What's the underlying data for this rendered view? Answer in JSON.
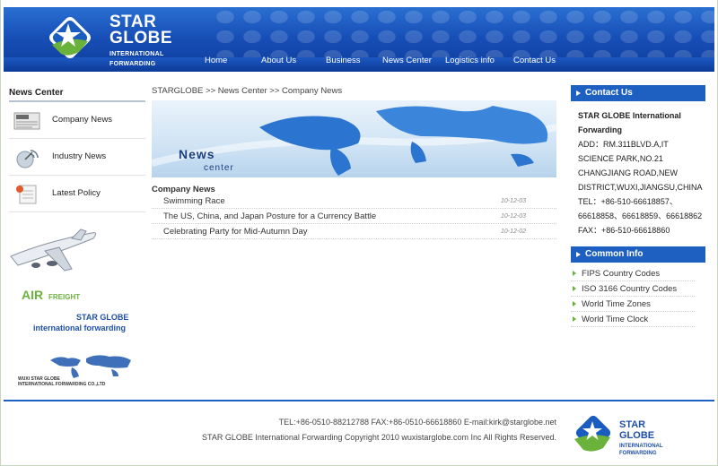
{
  "brand": {
    "line1": "STAR",
    "line2": "GLOBE",
    "line3": "INTERNATIONAL",
    "line4": "FORWARDING",
    "blue": "#1e5fc2",
    "green": "#6bb23c"
  },
  "nav": [
    "Home",
    "About Us",
    "Business",
    "News Center",
    "Logistics info",
    "Contact Us"
  ],
  "sidebar": {
    "title": "News Center",
    "items": [
      {
        "label": "Company News",
        "icon": "newspaper-icon"
      },
      {
        "label": "Industry News",
        "icon": "satellite-icon"
      },
      {
        "label": "Latest Policy",
        "icon": "document-icon"
      }
    ],
    "promo": {
      "air": "AIR",
      "freight": "FREIGHT",
      "brand1": "STAR GLOBE",
      "brand2": "international forwarding",
      "map_caption1": "WUXI STAR GLOBE",
      "map_caption2": "INTERNATIONAL FORWARDING CO.,LTD"
    }
  },
  "breadcrumb": "STARGLOBE >> News Center >> Company News",
  "banner": {
    "title": "News",
    "subtitle": "center"
  },
  "news": {
    "heading": "Company News",
    "rows": [
      {
        "title": "Swimming Race",
        "date": "10-12-03"
      },
      {
        "title": "The US, China, and Japan Posture for a Currency Battle",
        "date": "10-12-03"
      },
      {
        "title": "Celebrating Party for Mid-Autumn Day",
        "date": "10-12-02"
      }
    ]
  },
  "contact": {
    "title": "Contact Us",
    "name1": "STAR GLOBE International",
    "name2": "Forwarding",
    "addr1": "ADD：RM.311BLVD.A,IT",
    "addr2": "SCIENCE PARK,NO.21",
    "addr3": "CHANGJIANG ROAD,NEW",
    "addr4": "DISTRICT,WUXI,JIANGSU,CHINA",
    "tel1": "TEL：+86-510-66618857、",
    "tel2": "66618858、66618859、66618862",
    "fax": "FAX：+86-510-66618860"
  },
  "common": {
    "title": "Common Info",
    "items": [
      "FIPS Country Codes",
      "ISO 3166 Country Codes",
      "World Time Zones",
      "World Time Clock"
    ]
  },
  "footer": {
    "line1": "TEL:+86-0510-88212788 FAX:+86-0510-66618860 E-mail:kirk@starglobe.net",
    "line2": "STAR GLOBE International Forwarding Copyright 2010 wuxistarglobe.com Inc All Rights Reserved."
  }
}
